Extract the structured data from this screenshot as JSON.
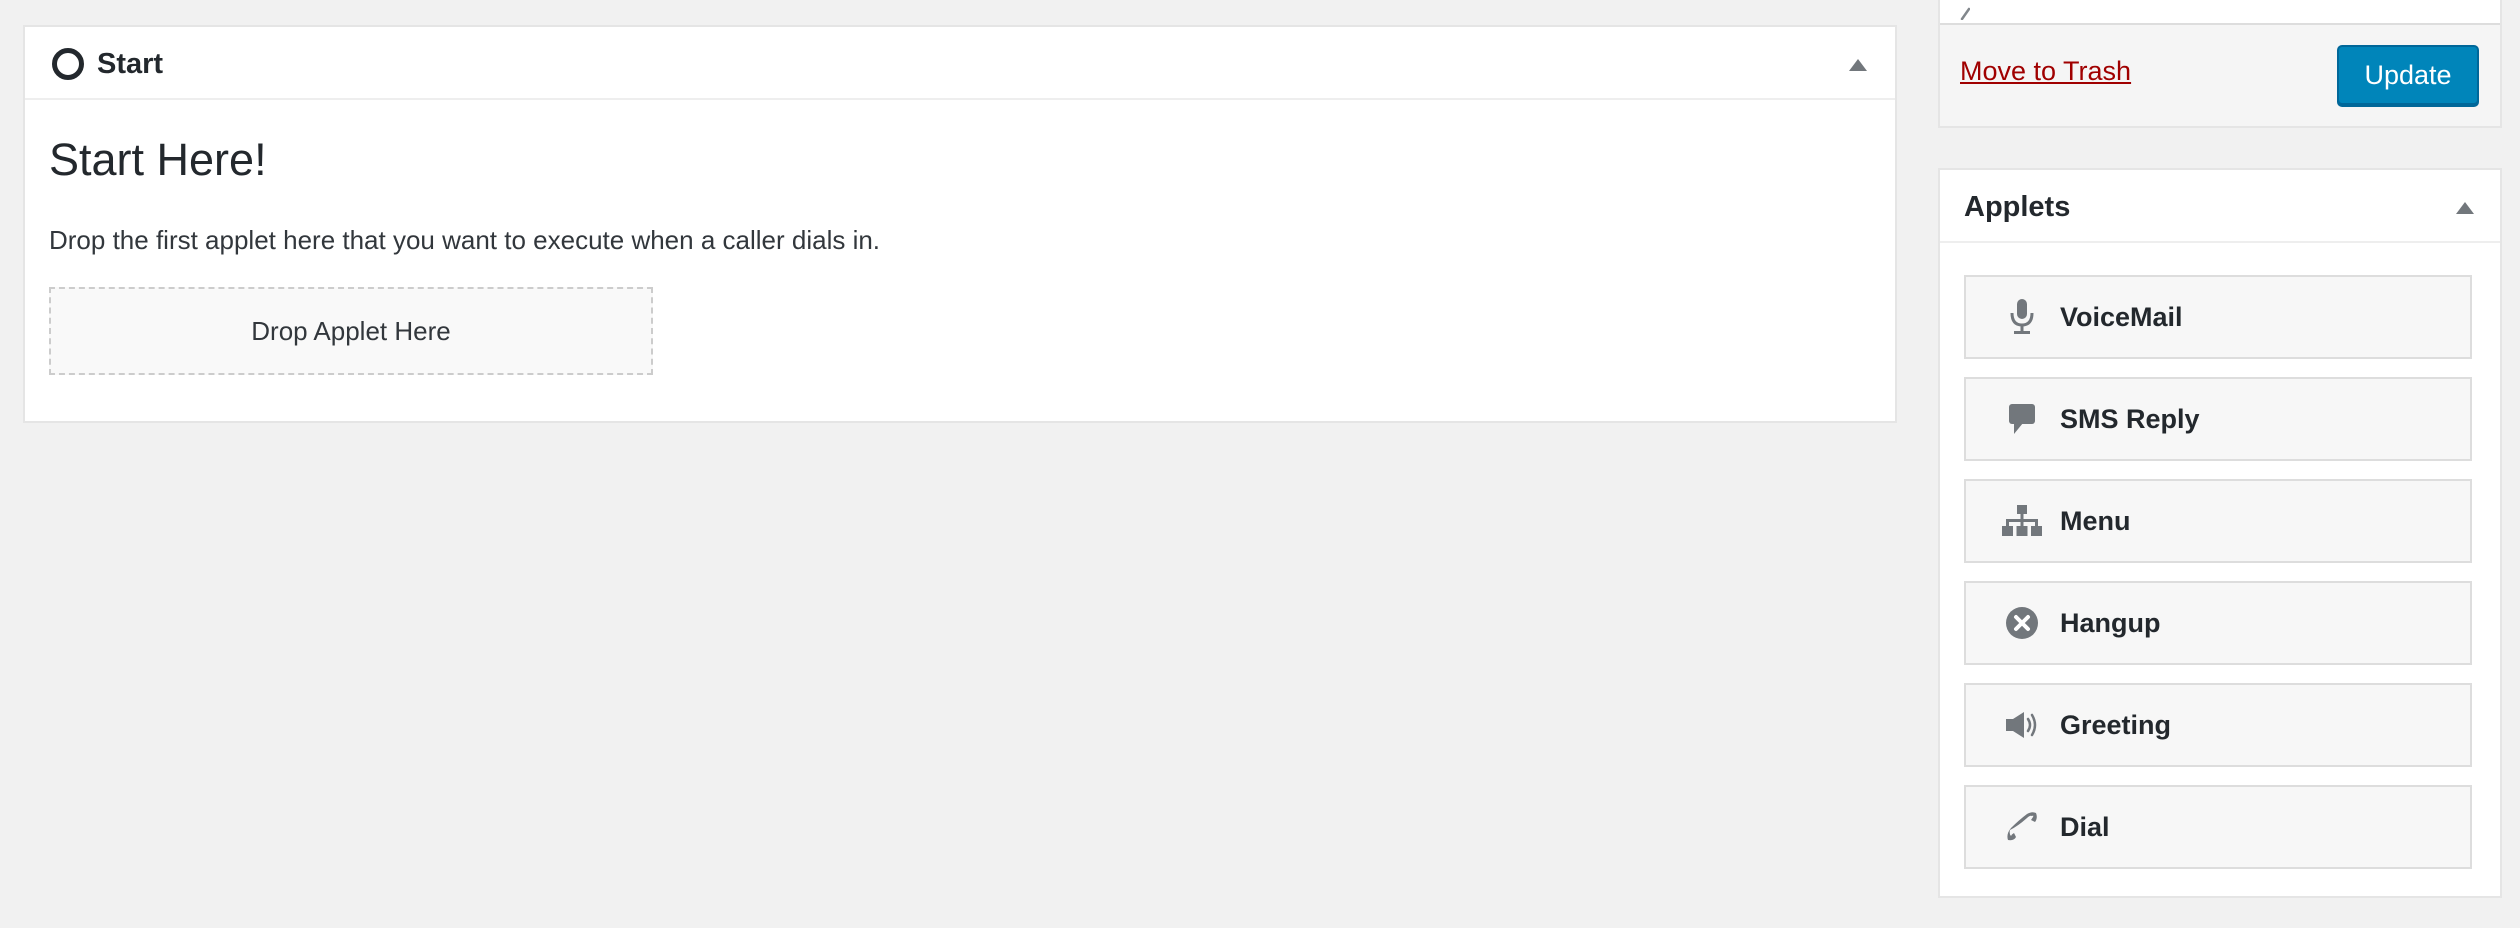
{
  "start_panel": {
    "title": "Start",
    "heading": "Start Here!",
    "description": "Drop the first applet here that you want to execute when a caller dials in.",
    "drop_zone_label": "Drop Applet Here"
  },
  "publish_panel": {
    "trash_label": "Move to Trash",
    "update_label": "Update"
  },
  "applets_panel": {
    "title": "Applets",
    "items": [
      {
        "label": "VoiceMail",
        "icon": "microphone-icon"
      },
      {
        "label": "SMS Reply",
        "icon": "speech-bubble-icon"
      },
      {
        "label": "Menu",
        "icon": "sitemap-icon"
      },
      {
        "label": "Hangup",
        "icon": "close-circle-icon"
      },
      {
        "label": "Greeting",
        "icon": "megaphone-icon"
      },
      {
        "label": "Dial",
        "icon": "phone-icon"
      }
    ]
  },
  "colors": {
    "background": "#f1f1f1",
    "panel": "#ffffff",
    "link_danger": "#a00000",
    "button_primary": "#0085ba",
    "icon_gray": "#72777c"
  }
}
